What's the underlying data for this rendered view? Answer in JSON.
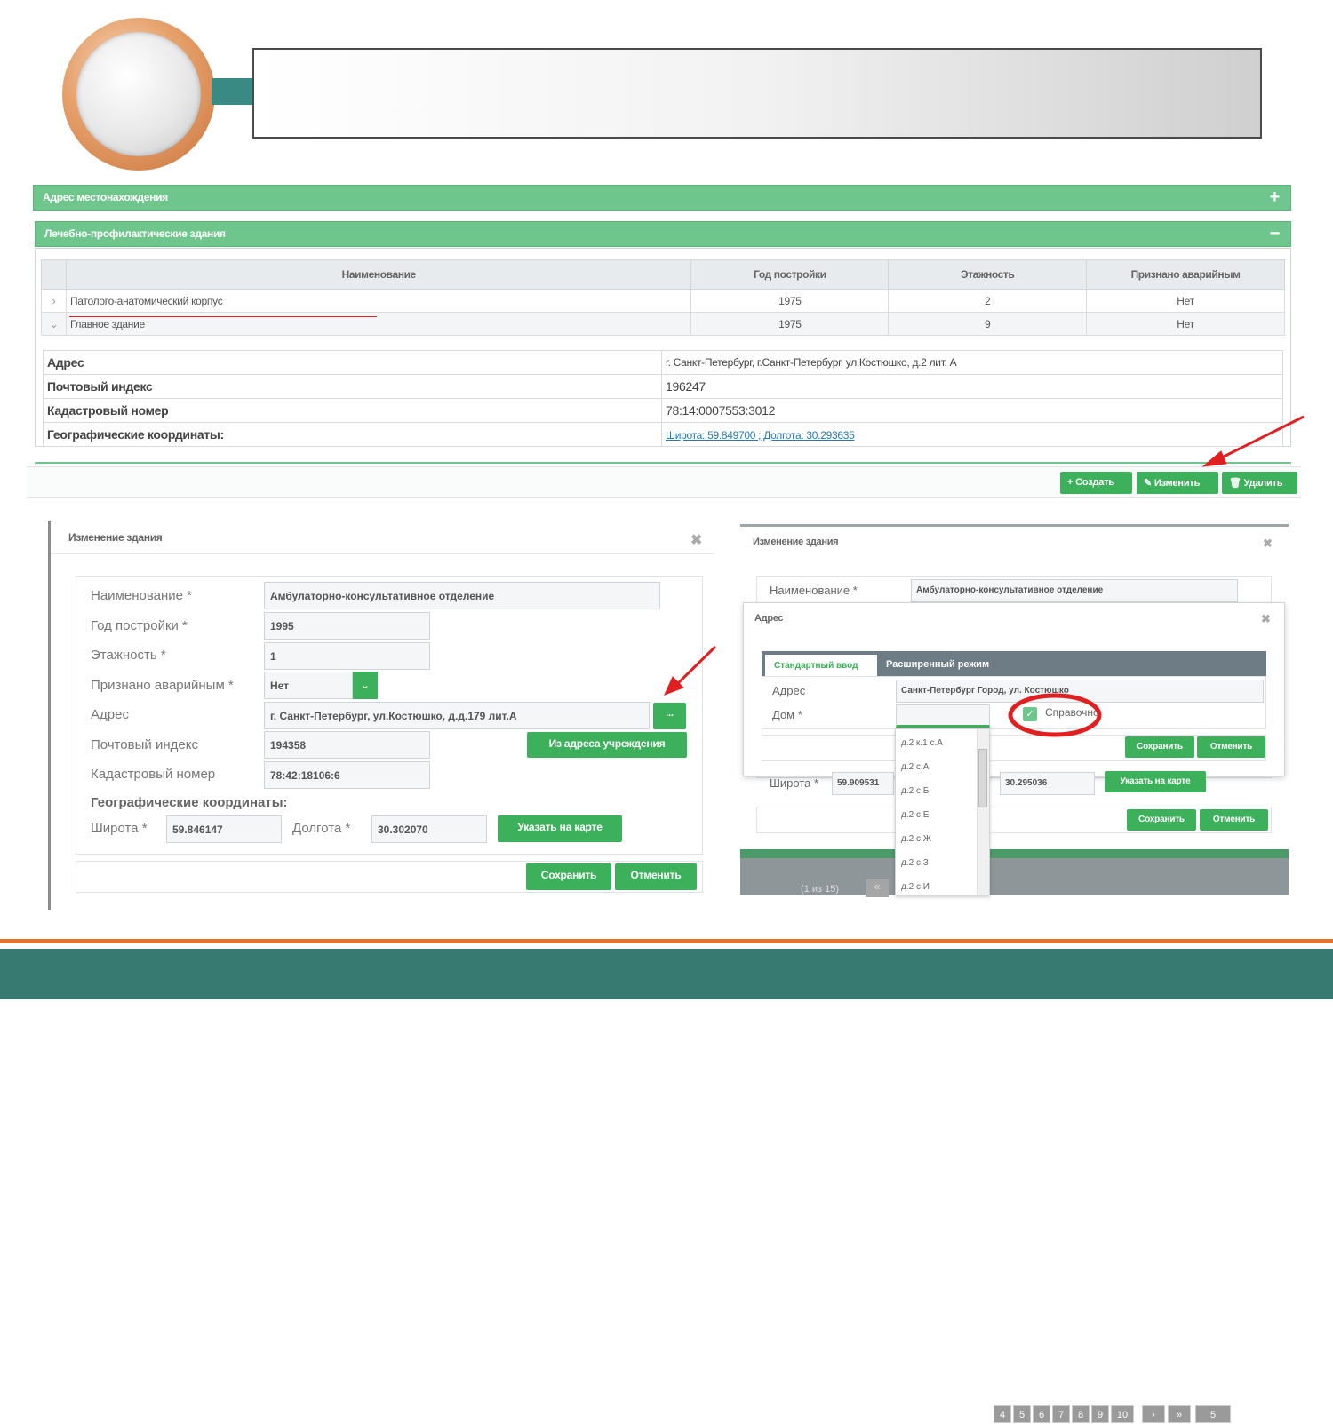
{
  "slide": {
    "title": ""
  },
  "top": {
    "panel1_title": "Адрес местонахождения",
    "panel1_sign": "+",
    "panel2_title": "Лечебно-профилактические здания",
    "panel2_sign": "−",
    "columns": [
      "Наименование",
      "Год постройки",
      "Этажность",
      "Признано аварийным"
    ],
    "rows": [
      {
        "arrow": "›",
        "name": "Патолого-анатомический корпус",
        "year": "1975",
        "floors": "2",
        "emergency": "Нет"
      },
      {
        "arrow": "⌄",
        "name": "Главное здание",
        "year": "1975",
        "floors": "9",
        "emergency": "Нет"
      }
    ],
    "details": [
      {
        "k": "Адрес",
        "v": "г. Санкт-Петербург, г.Санкт-Петербург, ул.Костюшко, д.2 лит. А"
      },
      {
        "k": "Почтовый индекс",
        "v": "196247"
      },
      {
        "k": "Кадастровый номер",
        "v": "78:14:0007553:3012"
      },
      {
        "k": "Географические координаты:",
        "v": "Широта: 59.849700 ; Долгота: 30.293635"
      }
    ],
    "btn_create": "+ Создать",
    "btn_edit": "✎ Изменить",
    "btn_delete": "🗑 Удалить"
  },
  "left_dialog": {
    "title": "Изменение здания",
    "close": "✖",
    "labels": {
      "name": "Наименование *",
      "year": "Год постройки *",
      "floors": "Этажность *",
      "emergency": "Признано аварийным *",
      "address": "Адрес",
      "postcode": "Почтовый индекс",
      "cadastre": "Кадастровый номер",
      "geo": "Географические координаты:",
      "lat": "Широта *",
      "lon": "Долгота *"
    },
    "values": {
      "name": "Амбулаторно-консультативное отделение",
      "year": "1995",
      "floors": "1",
      "emergency": "Нет",
      "address": "г. Санкт-Петербург,  ул.Костюшко,  д.д.179 лит.А",
      "postcode": "194358",
      "cadastre": "78:42:18106:6",
      "lat": "59.846147",
      "lon": "30.302070"
    },
    "btn_dots": "...",
    "btn_from_address": "Из адреса учреждения",
    "btn_map": "Указать на карте",
    "btn_save": "Сохранить",
    "btn_cancel": "Отменить"
  },
  "right_dialog": {
    "title": "Изменение здания",
    "close": "✖",
    "name_label": "Наименование *",
    "name_value": "Амбулаторно-консультативное отделение",
    "addr_title": "Адрес",
    "tab_standard": "Стандартный ввод",
    "tab_extended": "Расширенный режим",
    "addr_label": "Адрес",
    "addr_value": "Санкт-Петербург Город, ул. Костюшко",
    "house_label": "Дом *",
    "ref_checkbox": "Справочно",
    "dropdown": [
      "д.2 к.1 с.А",
      "д.2 с.А",
      "д.2 с.Б",
      "д.2 с.Е",
      "д.2 с.Ж",
      "д.2 с.З",
      "д.2 с.И"
    ],
    "btn_save": "Сохранить",
    "btn_cancel": "Отменить",
    "lat_label": "Широта *",
    "lat_value": "59.909531",
    "lon_value": "30.295036",
    "btn_map": "Указать на карте",
    "btn_save2": "Сохранить",
    "btn_cancel2": "Отменить",
    "pager_info": "(1 из 15)",
    "pages": [
      "4",
      "5",
      "6",
      "7",
      "8",
      "9",
      "10"
    ],
    "page_size": "5"
  },
  "colors": {
    "green": "#6fc68c",
    "button_green": "#3cb05a",
    "teal": "#367a72",
    "orange": "#e27430",
    "annotation_red": "#e02020"
  }
}
